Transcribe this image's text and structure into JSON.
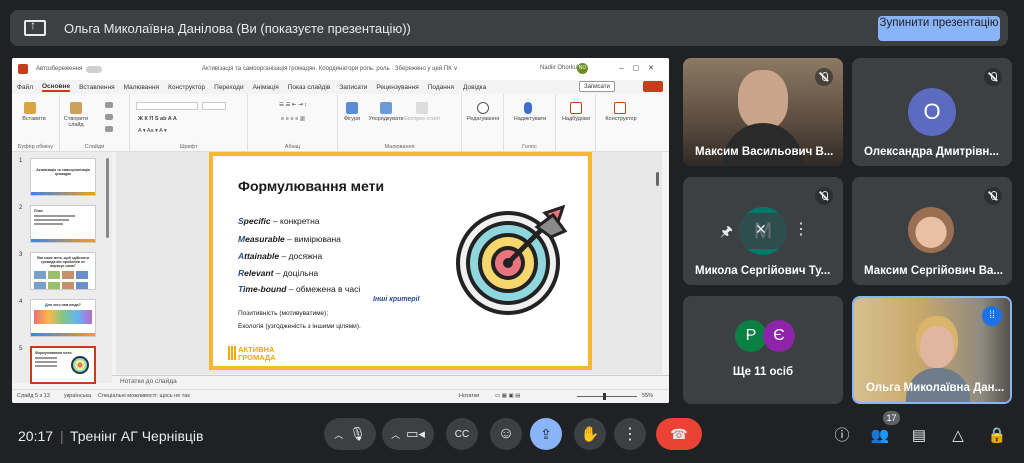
{
  "topbar": {
    "presenting_text": "Ольга Миколаївна Данілова (Ви (показуєте презентацію))",
    "stop_button": "Зупинити презентацію"
  },
  "ppt": {
    "autosave": "Автозбереження",
    "doc_title": "Активізація та самоорганізація громадян. Координатори роль: роль · Збережено у цей ПК ∨",
    "user_name": "Nadiir Ohorkul",
    "user_initials": "NO",
    "menu": [
      "Файл",
      "Основне",
      "Вставлення",
      "Малювання",
      "Конструктор",
      "Переходи",
      "Анімація",
      "Показ слайдів",
      "Записати",
      "Рецензування",
      "Подання",
      "Довідка"
    ],
    "active_menu": "Основне",
    "record_button": "Записати",
    "ribbon": {
      "paste": "Вставити",
      "clipboard": "Буфер обміну",
      "new_slide": "Створити слайд",
      "slides": "Слайди",
      "font": "Шрифт",
      "paragraph": "Абзац",
      "shapes": "Фігури",
      "arrange": "Упорядкувати",
      "quick_styles": "Експрес-стилі",
      "drawing": "Малювання",
      "editing": "Редагування",
      "dictate": "Надиктувати",
      "voice": "Голос",
      "addins": "Надбудови",
      "designer": "Конструктор"
    },
    "thumbnails": [
      {
        "num": "1",
        "text": "Активізація та самоорганізація громадян"
      },
      {
        "num": "2",
        "text": "План"
      },
      {
        "num": "3",
        "text": "Яка саме мета, щоб здійснити громада він проблеми не вирішує сама?"
      },
      {
        "num": "4",
        "text": "Для чого нам люди?"
      },
      {
        "num": "5",
        "text": "Формулювання мети"
      }
    ],
    "slide": {
      "title": "Формулювання мети",
      "smart": [
        {
          "key": "Specific",
          "first": "S",
          "rest": "pecific",
          "desc": " – конкретна"
        },
        {
          "key": "Measurable",
          "first": "M",
          "rest": "easurable",
          "desc": " – вимірювана"
        },
        {
          "key": "Attainable",
          "first": "A",
          "rest": "ttainable",
          "desc": " – досяжна"
        },
        {
          "key": "Relevant",
          "first": "R",
          "rest": "elevant",
          "desc": " – доцільна"
        },
        {
          "key": "Time-bound",
          "first": "T",
          "rest": "ime-bound",
          "desc": " – обмежена в часі"
        }
      ],
      "other_criteria": "Інші критерії",
      "extra1": "Позитивність (мотивуватиме);",
      "extra2": "Екологія (узгодженість з іншими цілями).",
      "logo": "АКТИВНА ГРОМАДА"
    },
    "notes": "Нотатки до слайда",
    "status": {
      "slide": "Слайд 5 з 13",
      "lang": "українська",
      "accessibility": "Спеціальні можливості: щось не так",
      "notes_btn": "Нотатки",
      "zoom": "55%"
    }
  },
  "tiles": [
    {
      "name": "Максим Васильович В..."
    },
    {
      "name": "Олександра Дмитрівн...",
      "initial": "О",
      "color": "#5c6bc0"
    },
    {
      "name": "Микола Сергійович Ту...",
      "initial": "М",
      "color": "#00796b"
    },
    {
      "name": "Максим Сергійович Ва..."
    },
    {
      "name": "Ще 11 осіб",
      "init1": "Р",
      "init2": "Є",
      "color1": "#0b8043",
      "color2": "#8e24aa"
    },
    {
      "name": "Ольга Миколаївна Дан..."
    }
  ],
  "bottombar": {
    "time": "20:17",
    "meeting": "Тренінг АГ Чернівців",
    "participants_count": "17"
  },
  "colors": {
    "accent": "#8ab4f8",
    "end_call": "#ea4335",
    "ppt_brand": "#c43e1c"
  }
}
